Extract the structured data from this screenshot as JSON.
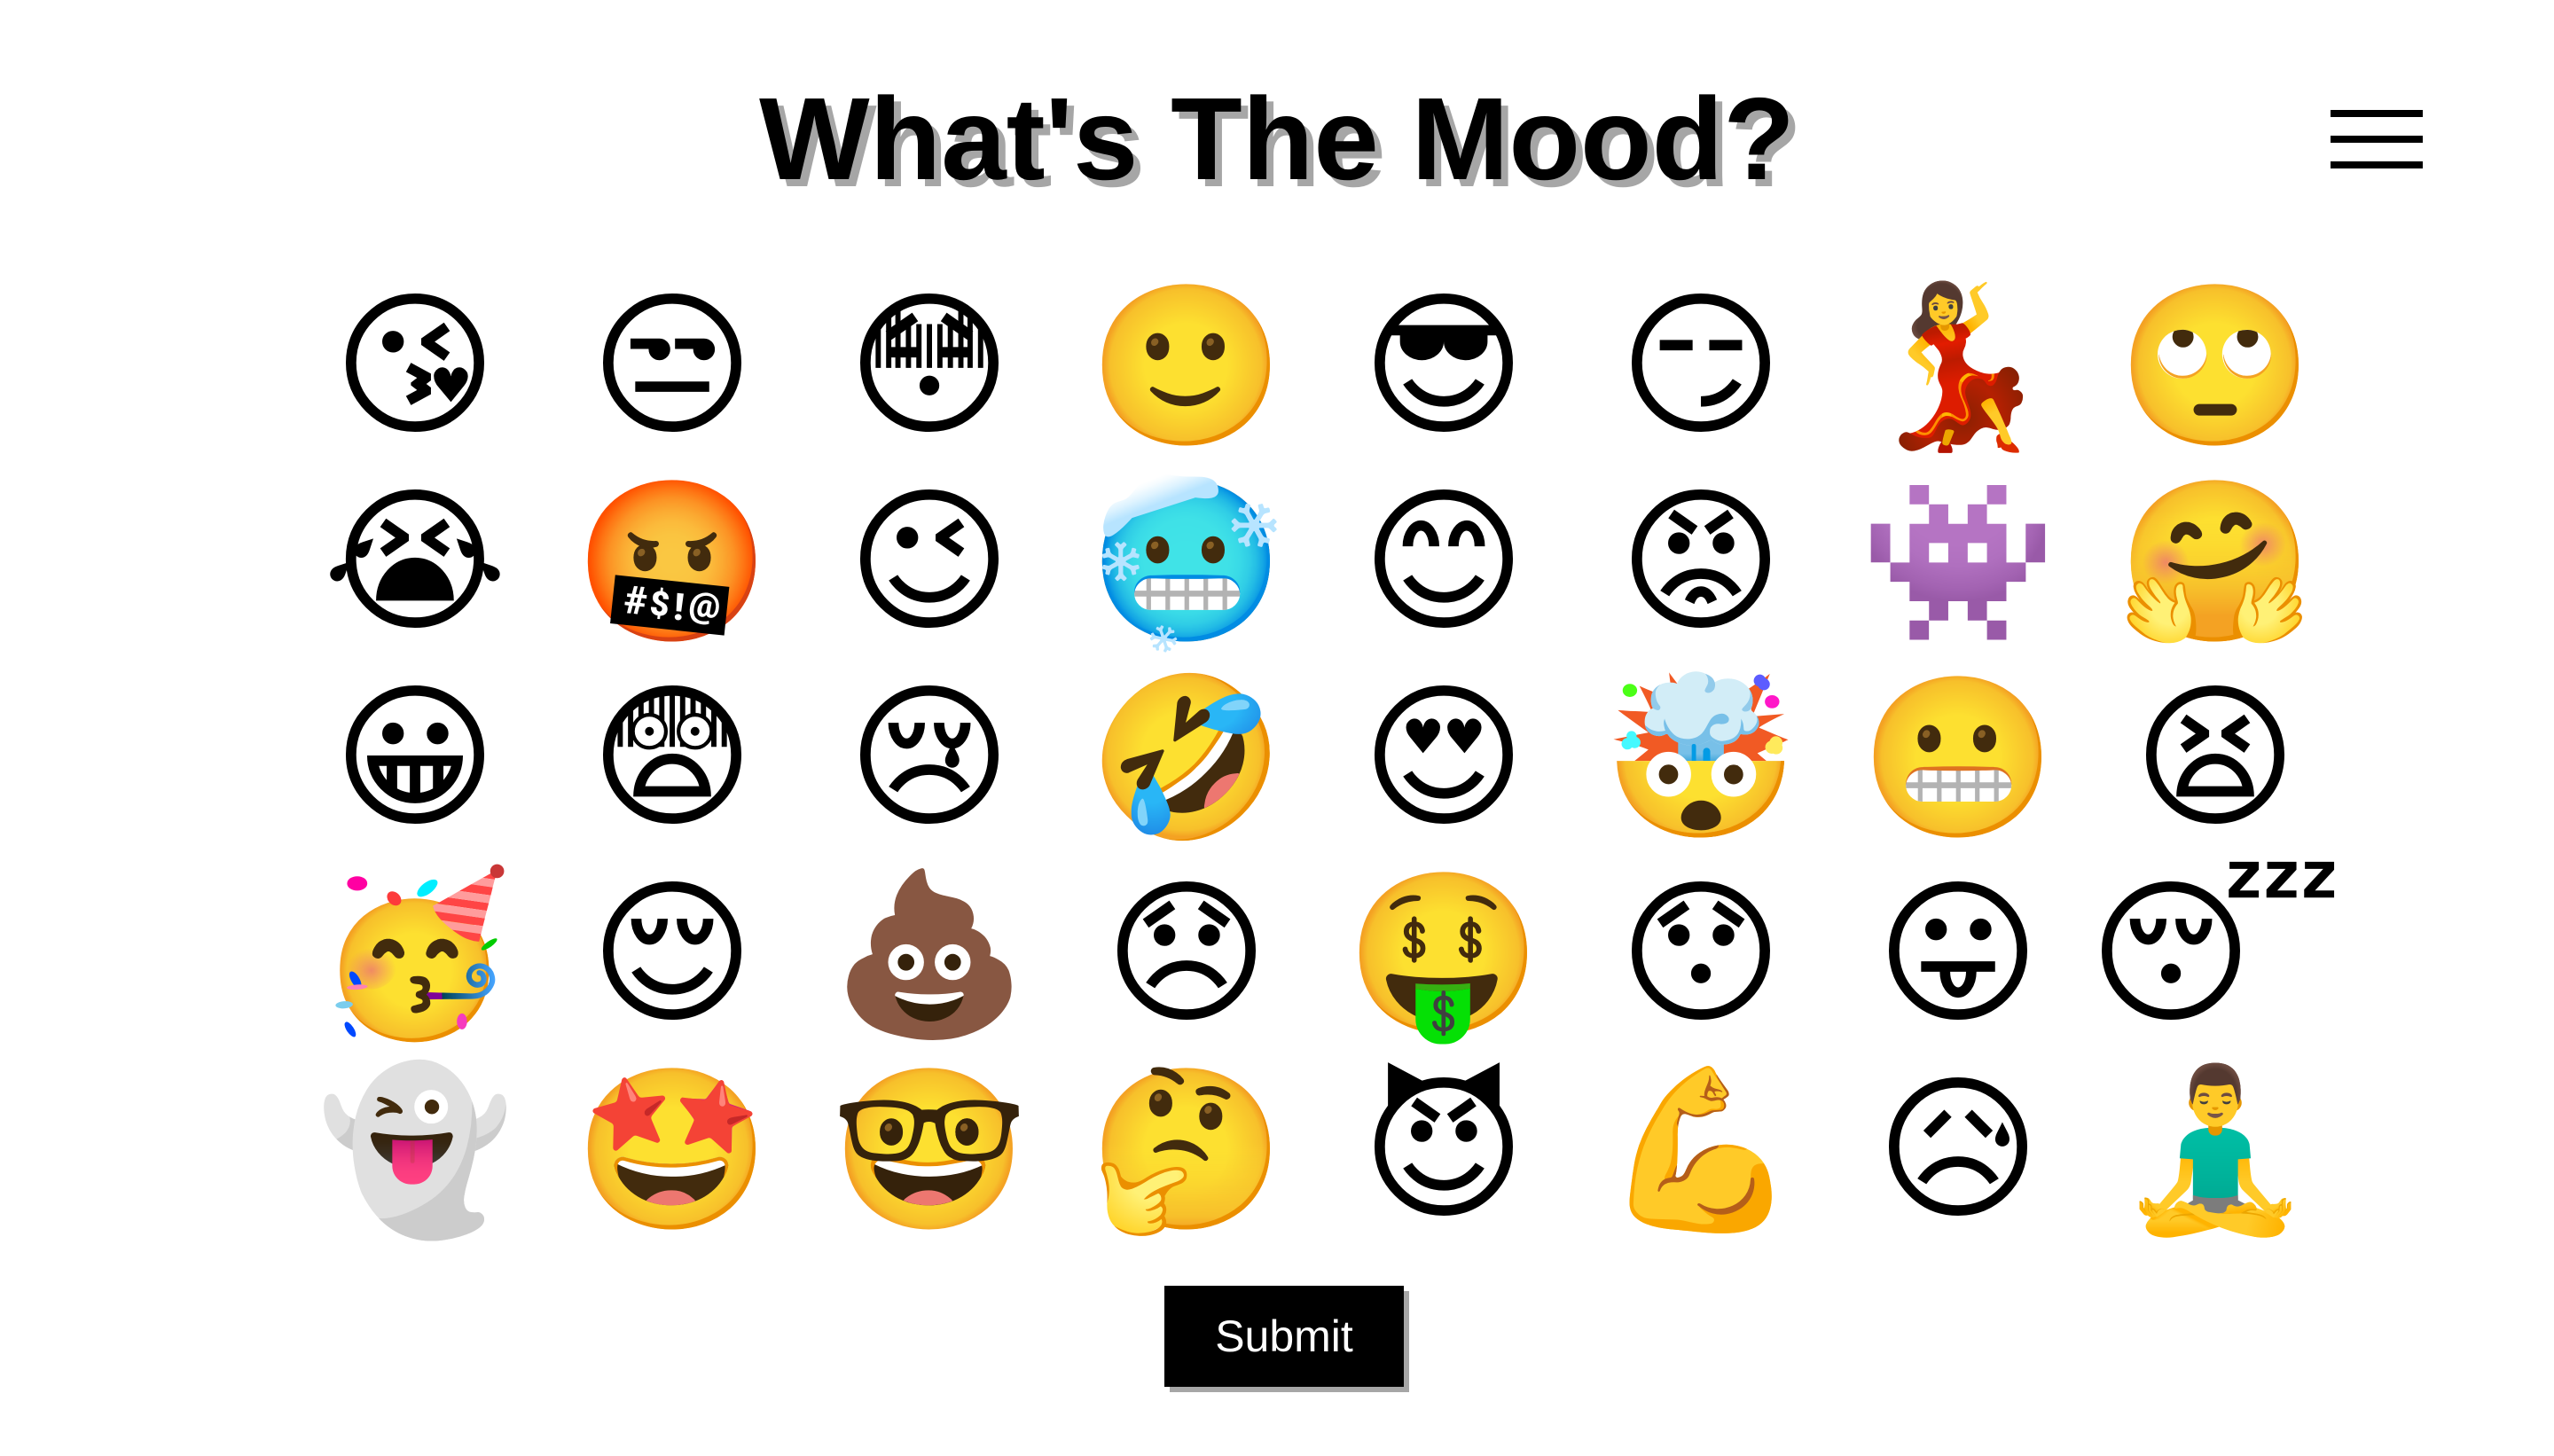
{
  "header": {
    "title": "What's The Mood?",
    "menu_icon": "hamburger-menu-icon"
  },
  "emojis": [
    {
      "name": "kissing-heart",
      "glyph": "😘"
    },
    {
      "name": "unamused",
      "glyph": "😒"
    },
    {
      "name": "flushed",
      "glyph": "😳"
    },
    {
      "name": "slightly-smiling",
      "glyph": "🙂"
    },
    {
      "name": "sunglasses",
      "glyph": "😎"
    },
    {
      "name": "smirk",
      "glyph": "😏"
    },
    {
      "name": "dancer",
      "glyph": "💃"
    },
    {
      "name": "rolling-eyes",
      "glyph": "🙄"
    },
    {
      "name": "loudly-crying",
      "glyph": "😭"
    },
    {
      "name": "cursing",
      "glyph": "🤬"
    },
    {
      "name": "wink",
      "glyph": "😉"
    },
    {
      "name": "cold-face",
      "glyph": "🥶"
    },
    {
      "name": "blush",
      "glyph": "😊"
    },
    {
      "name": "angry",
      "glyph": "😡"
    },
    {
      "name": "space-invader",
      "glyph": "👾"
    },
    {
      "name": "hugging",
      "glyph": "🤗"
    },
    {
      "name": "grinning",
      "glyph": "😀"
    },
    {
      "name": "fearful",
      "glyph": "😨"
    },
    {
      "name": "crying",
      "glyph": "😢"
    },
    {
      "name": "rofl",
      "glyph": "🤣"
    },
    {
      "name": "heart-eyes",
      "glyph": "😍"
    },
    {
      "name": "exploding-head",
      "glyph": "🤯"
    },
    {
      "name": "grimacing",
      "glyph": "😬"
    },
    {
      "name": "tired",
      "glyph": "😫"
    },
    {
      "name": "partying",
      "glyph": "🥳"
    },
    {
      "name": "relieved",
      "glyph": "😌"
    },
    {
      "name": "pile-of-poo",
      "glyph": "💩"
    },
    {
      "name": "disappointed",
      "glyph": "😞"
    },
    {
      "name": "money-mouth",
      "glyph": "🤑"
    },
    {
      "name": "hushed",
      "glyph": "😯"
    },
    {
      "name": "tongue-out",
      "glyph": "😛"
    },
    {
      "name": "sleeping",
      "glyph": "😴"
    },
    {
      "name": "ghost",
      "glyph": "👻"
    },
    {
      "name": "star-struck",
      "glyph": "🤩"
    },
    {
      "name": "nerd",
      "glyph": "🤓"
    },
    {
      "name": "thinking",
      "glyph": "🤔"
    },
    {
      "name": "smiling-devil",
      "glyph": "😈"
    },
    {
      "name": "flexed-biceps",
      "glyph": "💪"
    },
    {
      "name": "sad-sweat",
      "glyph": "😥"
    },
    {
      "name": "lotus-position",
      "glyph": "🧘‍♂️"
    }
  ],
  "submit": {
    "label": "Submit"
  }
}
